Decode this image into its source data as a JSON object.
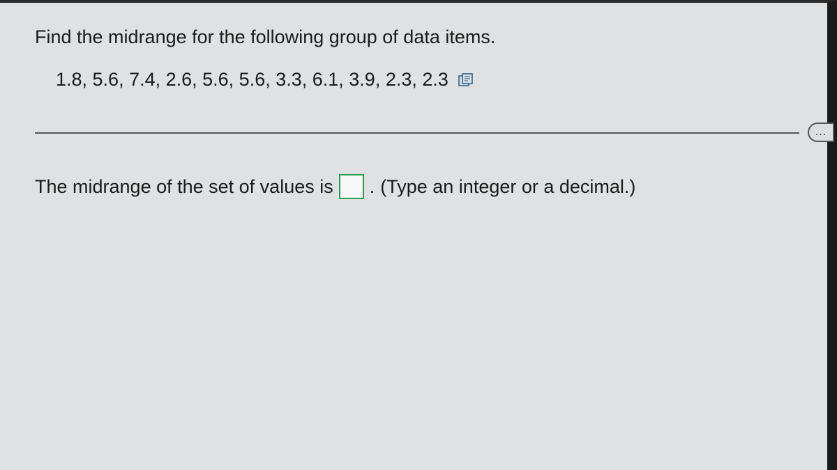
{
  "question": {
    "prompt": "Find the midrange for the following group of data items.",
    "data_values": "1.8, 5.6, 7.4, 2.6, 5.6, 5.6, 3.3, 6.1, 3.9, 2.3, 2.3"
  },
  "answer": {
    "prefix": "The midrange of the set of values is",
    "input_value": "",
    "period": ".",
    "hint": "(Type an integer or a decimal.)"
  },
  "more_indicator": "..."
}
